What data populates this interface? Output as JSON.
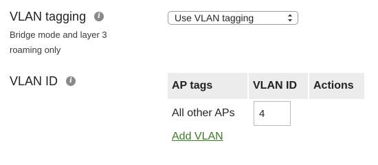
{
  "vlan_tagging": {
    "label": "VLAN tagging",
    "info_icon": "info-icon",
    "sublabel_line1": "Bridge mode and layer 3",
    "sublabel_line2": "roaming only",
    "select_value": "Use VLAN tagging"
  },
  "vlan_id": {
    "label": "VLAN ID",
    "info_icon": "info-icon",
    "table": {
      "headers": [
        "AP tags",
        "VLAN ID",
        "Actions"
      ],
      "rows": [
        {
          "ap_tags": "All other APs",
          "vlan_id": "4",
          "actions": ""
        }
      ]
    },
    "add_link": "Add VLAN"
  },
  "colors": {
    "link": "#3d7a28",
    "header_bg": "#ececec",
    "icon_bg": "#8a8a8a"
  }
}
